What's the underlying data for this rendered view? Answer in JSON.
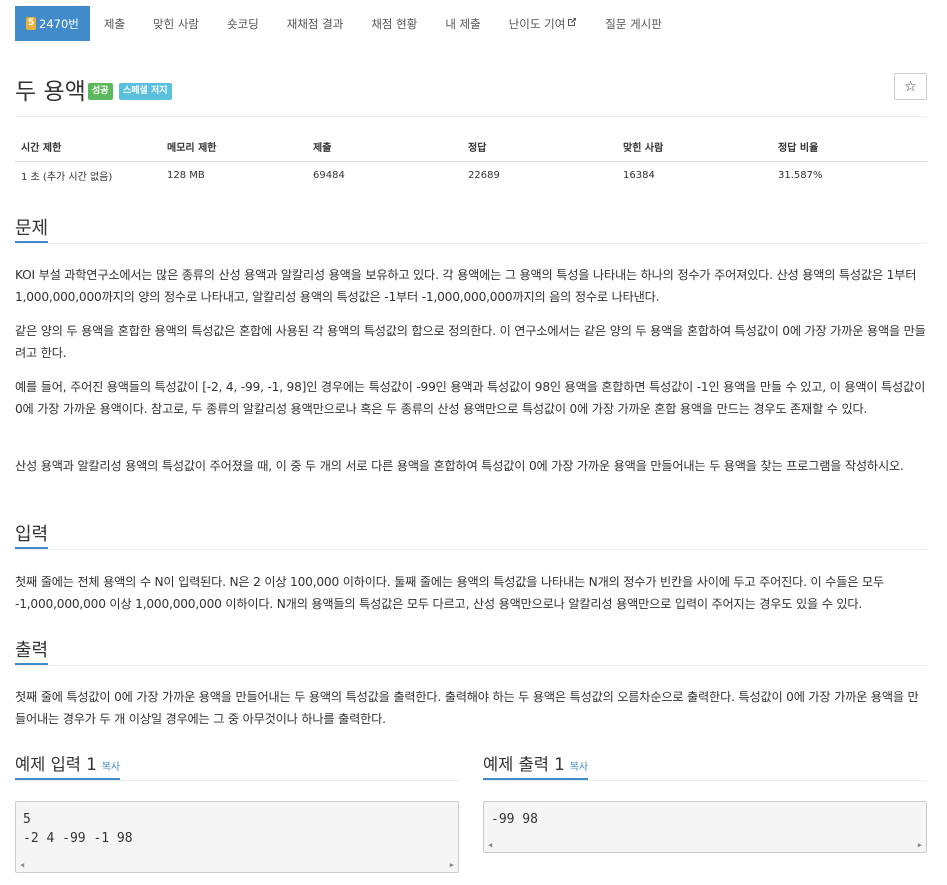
{
  "nav": {
    "problem_number_badge": "5",
    "problem_number": "2470번",
    "tabs": [
      "제출",
      "맞힌 사람",
      "숏코딩",
      "재채점 결과",
      "채점 현황",
      "내 제출",
      "난이도 기여",
      "질문 게시판"
    ]
  },
  "header": {
    "title": "두 용액",
    "label_success": "성공",
    "label_special": "스페셜 저지",
    "star_icon": "☆"
  },
  "info_table": {
    "headers": [
      "시간 제한",
      "메모리 제한",
      "제출",
      "정답",
      "맞힌 사람",
      "정답 비율"
    ],
    "values": [
      "1 초 (추가 시간 없음)",
      "128 MB",
      "69484",
      "22689",
      "16384",
      "31.587%"
    ]
  },
  "problem": {
    "heading": "문제",
    "paragraphs": [
      "KOI 부설 과학연구소에서는 많은 종류의 산성 용액과 알칼리성 용액을 보유하고 있다. 각 용액에는 그 용액의 특성을 나타내는 하나의 정수가 주어져있다. 산성 용액의 특성값은 1부터 1,000,000,000까지의 양의 정수로 나타내고, 알칼리성 용액의 특성값은 -1부터 -1,000,000,000까지의 음의 정수로 나타낸다.",
      "같은 양의 두 용액을 혼합한 용액의 특성값은 혼합에 사용된 각 용액의 특성값의 합으로 정의한다. 이 연구소에서는 같은 양의 두 용액을 혼합하여 특성값이 0에 가장 가까운 용액을 만들려고 한다.",
      "예를 들어, 주어진 용액들의 특성값이 [-2, 4, -99, -1, 98]인 경우에는 특성값이 -99인 용액과 특성값이 98인 용액을 혼합하면 특성값이 -1인 용액을 만들 수 있고, 이 용액이 특성값이 0에 가장 가까운 용액이다. 참고로, 두 종류의 알칼리성 용액만으로나 혹은 두 종류의 산성 용액만으로 특성값이 0에 가장 가까운 혼합 용액을 만드는 경우도 존재할 수 있다.",
      "산성 용액과 알칼리성 용액의 특성값이 주어졌을 때, 이 중 두 개의 서로 다른 용액을 혼합하여 특성값이 0에 가장 가까운 용액을 만들어내는 두 용액을 찾는 프로그램을 작성하시오."
    ]
  },
  "input": {
    "heading": "입력",
    "text": "첫째 줄에는 전체 용액의 수 N이 입력된다. N은 2 이상 100,000 이하이다. 둘째 줄에는 용액의 특성값을 나타내는 N개의 정수가 빈칸을 사이에 두고 주어진다. 이 수들은 모두 -1,000,000,000 이상 1,000,000,000 이하이다. N개의 용액들의 특성값은 모두 다르고, 산성 용액만으로나 알칼리성 용액만으로 입력이 주어지는 경우도 있을 수 있다."
  },
  "output": {
    "heading": "출력",
    "text": "첫째 줄에 특성값이 0에 가장 가까운 용액을 만들어내는 두 용액의 특성값을 출력한다. 출력해야 하는 두 용액은 특성값의 오름차순으로 출력한다. 특성값이 0에 가장 가까운 용액을 만들어내는 경우가 두 개 이상일 경우에는 그 중 아무것이나 하나를 출력한다."
  },
  "samples": {
    "input_heading": "예제 입력 1",
    "output_heading": "예제 출력 1",
    "copy_label": "복사",
    "input_code": "5\n-2 4 -99 -1 98",
    "output_code": "-99 98"
  }
}
